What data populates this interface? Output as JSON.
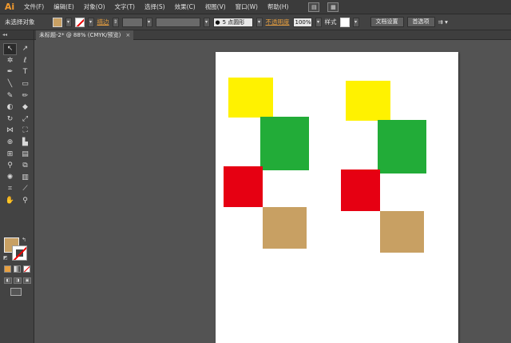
{
  "app": {
    "logo": "Ai"
  },
  "menu": [
    {
      "label": "文件(F)",
      "name": "menu-file"
    },
    {
      "label": "编辑(E)",
      "name": "menu-edit"
    },
    {
      "label": "对象(O)",
      "name": "menu-object"
    },
    {
      "label": "文字(T)",
      "name": "menu-type"
    },
    {
      "label": "选择(S)",
      "name": "menu-select"
    },
    {
      "label": "效果(C)",
      "name": "menu-effect"
    },
    {
      "label": "视图(V)",
      "name": "menu-view"
    },
    {
      "label": "窗口(W)",
      "name": "menu-window"
    },
    {
      "label": "帮助(H)",
      "name": "menu-help"
    }
  ],
  "control_bar": {
    "selection_status": "未选择对象",
    "fill_color": "#c8a063",
    "stroke_label": "描边",
    "brush_label": "5 点圆形",
    "opacity_label": "不透明度",
    "opacity_value": "100%",
    "style_label": "样式",
    "doc_setup_button": "文档设置",
    "preferences_button": "首选项"
  },
  "document_tab": {
    "title": "未标题-2* @ 88% (CMYK/预览)",
    "close": "×"
  },
  "toolbar": {
    "fill_color": "#c8a063",
    "stroke": "none"
  },
  "colors": {
    "yellow": "#fff200",
    "green": "#22ac38",
    "red": "#e60012",
    "tan": "#c8a063",
    "artboard": "#ffffff"
  },
  "artwork": {
    "group_left": [
      "yellow",
      "green",
      "red",
      "tan"
    ],
    "group_right": [
      "yellow",
      "green",
      "red",
      "tan"
    ]
  }
}
